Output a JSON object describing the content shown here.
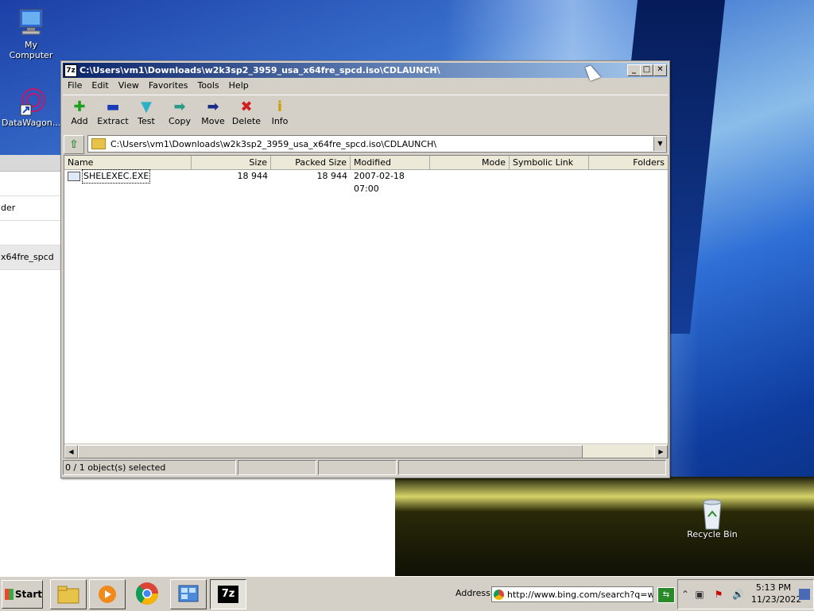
{
  "desktop": {
    "icons": [
      {
        "label": "My Computer",
        "icon": "computer-icon"
      },
      {
        "label": "DataWagon...",
        "icon": "datawagon-shortcut-icon"
      },
      {
        "label": "Recycle Bin",
        "icon": "recycle-bin-icon"
      }
    ],
    "background_window": {
      "rows": [
        "der",
        "x64fre_spcd"
      ]
    }
  },
  "window": {
    "title": "C:\\Users\\vm1\\Downloads\\w2k3sp2_3959_usa_x64fre_spcd.iso\\CDLAUNCH\\",
    "app_icon_text": "7z",
    "menu": [
      "File",
      "Edit",
      "View",
      "Favorites",
      "Tools",
      "Help"
    ],
    "toolbar": [
      {
        "label": "Add",
        "icon": "add-icon",
        "color": "#1e9e1e"
      },
      {
        "label": "Extract",
        "icon": "extract-icon",
        "color": "#1a3bb8"
      },
      {
        "label": "Test",
        "icon": "test-icon",
        "color": "#2ab0c8"
      },
      {
        "label": "Copy",
        "icon": "copy-icon",
        "color": "#2a9a8a"
      },
      {
        "label": "Move",
        "icon": "move-icon",
        "color": "#1a2a8a"
      },
      {
        "label": "Delete",
        "icon": "delete-icon",
        "color": "#d02020"
      },
      {
        "label": "Info",
        "icon": "info-icon",
        "color": "#c8a000"
      }
    ],
    "address_path": "C:\\Users\\vm1\\Downloads\\w2k3sp2_3959_usa_x64fre_spcd.iso\\CDLAUNCH\\",
    "columns": [
      "Name",
      "Size",
      "Packed Size",
      "Modified",
      "Mode",
      "Symbolic Link",
      "Folders"
    ],
    "files": [
      {
        "name": "SHELEXEC.EXE",
        "size": "18 944",
        "packed_size": "18 944",
        "modified": "2007-02-18 07:00",
        "mode": "",
        "symlink": "",
        "folders": ""
      }
    ],
    "status": "0 / 1 object(s) selected"
  },
  "taskbar": {
    "start_label": "Start",
    "apps": [
      {
        "name": "explorer",
        "icon": "file-explorer-icon"
      },
      {
        "name": "media-player",
        "icon": "media-player-icon"
      },
      {
        "name": "chrome",
        "icon": "chrome-icon"
      },
      {
        "name": "control-panel",
        "icon": "control-panel-icon"
      },
      {
        "name": "7zip",
        "icon": "7zip-icon",
        "label": "7z"
      }
    ],
    "address_label": "Address",
    "address_value": "http://www.bing.com/search?q=w",
    "clock_time": "5:13 PM",
    "clock_date": "11/23/2022"
  }
}
